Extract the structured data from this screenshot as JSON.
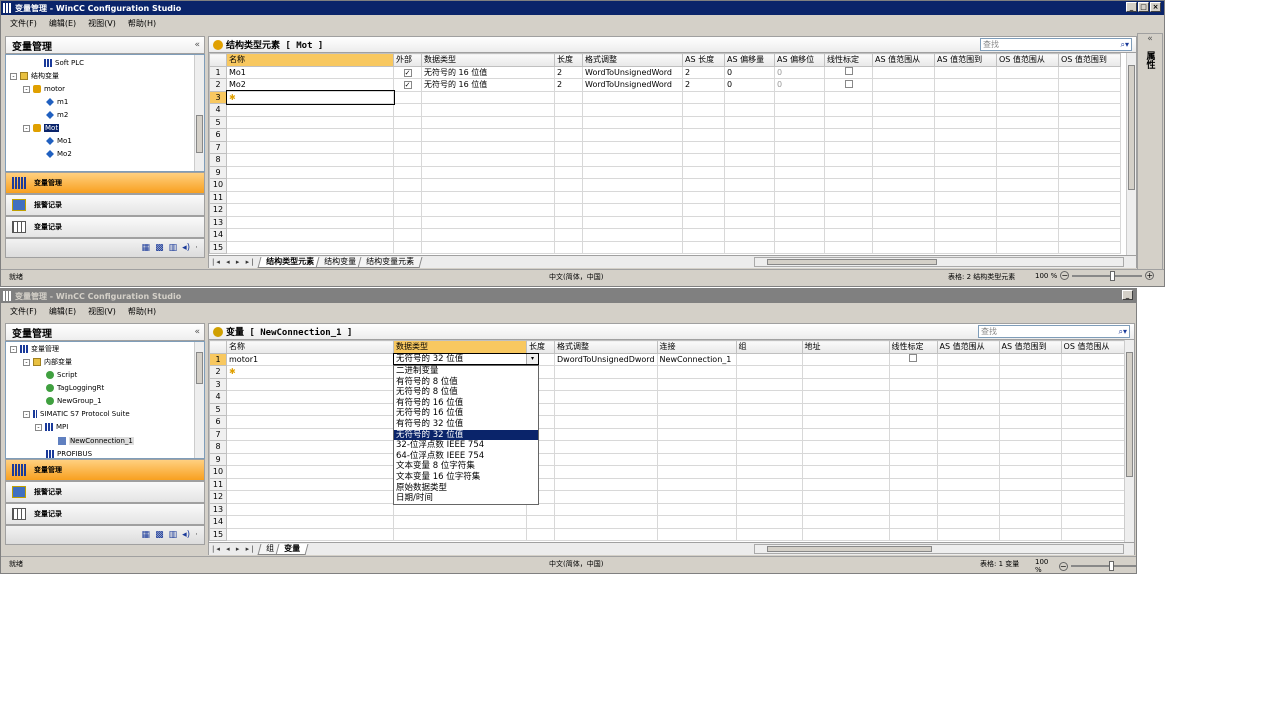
{
  "w1": {
    "title": "变量管理 - WinCC Configuration Studio",
    "menu": [
      "文件(F)",
      "编辑(E)",
      "视图(V)",
      "帮助(H)"
    ],
    "left_title": "变量管理",
    "tree": [
      {
        "label": "Soft PLC",
        "icon": "bars"
      },
      {
        "label": "结构变量",
        "icon": "folder",
        "pm": "-"
      },
      {
        "label": "motor",
        "icon": "struct",
        "pm": "-"
      },
      {
        "label": "m1",
        "icon": "var"
      },
      {
        "label": "m2",
        "icon": "var"
      },
      {
        "label": "Mot",
        "icon": "struct",
        "pm": "-",
        "selected": true
      },
      {
        "label": "Mo1",
        "icon": "var"
      },
      {
        "label": "Mo2",
        "icon": "var"
      }
    ],
    "nav": [
      "变量管理",
      "报警记录",
      "变量记录"
    ],
    "header_icon_label": "结构类型元素 [ Mot ]",
    "search_placeholder": "查找",
    "columns": [
      "名称",
      "外部",
      "数据类型",
      "长度",
      "格式调整",
      "AS 长度",
      "AS 偏移量",
      "AS 偏移位",
      "线性标定",
      "AS 值范围从",
      "AS 值范围到",
      "OS 值范围从",
      "OS 值范围到"
    ],
    "rows": [
      {
        "n": "1",
        "name": "Mo1",
        "ext": "✓",
        "type": "无符号的 16 位值",
        "len": "2",
        "fmt": "WordToUnsignedWord",
        "aslen": "2",
        "asoff": "0",
        "asbit": "0"
      },
      {
        "n": "2",
        "name": "Mo2",
        "ext": "✓",
        "type": "无符号的 16 位值",
        "len": "2",
        "fmt": "WordToUnsignedWord",
        "aslen": "2",
        "asoff": "0",
        "asbit": "0"
      }
    ],
    "empty_rows": [
      "3",
      "4",
      "5",
      "6",
      "7",
      "8",
      "9",
      "10",
      "11",
      "12",
      "13",
      "14",
      "15"
    ],
    "tabs": [
      "结构类型元素",
      "结构变量",
      "结构变量元素"
    ],
    "status_left": "就绪",
    "status_mid": "中文(简体，中国)",
    "status_right": "表格: 2 结构类型元素",
    "zoom": "100 %",
    "right_label": "属性"
  },
  "w2": {
    "title": "变量管理 - WinCC Configuration Studio",
    "menu": [
      "文件(F)",
      "编辑(E)",
      "视图(V)",
      "帮助(H)"
    ],
    "left_title": "变量管理",
    "tree": [
      {
        "label": "变量管理",
        "icon": "bars",
        "pm": "-"
      },
      {
        "label": "内部变量",
        "icon": "folder",
        "pm": "-"
      },
      {
        "label": "Script",
        "icon": "db"
      },
      {
        "label": "TagLoggingRt",
        "icon": "db"
      },
      {
        "label": "NewGroup_1",
        "icon": "db"
      },
      {
        "label": "SIMATIC S7 Protocol Suite",
        "icon": "bars",
        "pm": "-"
      },
      {
        "label": "MPI",
        "icon": "bars",
        "pm": "-"
      },
      {
        "label": "NewConnection_1",
        "icon": "conn",
        "hl": true
      },
      {
        "label": "PROFIBUS",
        "icon": "bars"
      }
    ],
    "nav": [
      "变量管理",
      "报警记录",
      "变量记录"
    ],
    "header_icon_label": "变量 [ NewConnection_1 ]",
    "search_placeholder": "查找",
    "columns": [
      "名称",
      "数据类型",
      "长度",
      "格式调整",
      "连接",
      "组",
      "地址",
      "线性标定",
      "AS 值范围从",
      "AS 值范围到",
      "OS 值范围从"
    ],
    "rows": [
      {
        "n": "1",
        "name": "motor1",
        "type": "无符号的 32 位值",
        "len": "",
        "fmt": "DwordToUnsignedDword",
        "conn": "NewConnection_1"
      }
    ],
    "empty_rows": [
      "2",
      "3",
      "4",
      "5",
      "6",
      "7",
      "8",
      "9",
      "10",
      "11",
      "12",
      "13",
      "14",
      "15"
    ],
    "dropdown": [
      "二进制变量",
      "有符号的 8 位值",
      "无符号的 8 位值",
      "有符号的 16 位值",
      "无符号的 16 位值",
      "有符号的 32 位值",
      "无符号的 32 位值",
      "32-位浮点数 IEEE 754",
      "64-位浮点数 IEEE 754",
      "文本变量 8 位字符集",
      "文本变量 16 位字符集",
      "原始数据类型",
      "日期/时间"
    ],
    "dropdown_selected": 6,
    "tabs": [
      "组",
      "变量"
    ],
    "status_left": "就绪",
    "status_mid": "中文(简体，中国)",
    "status_right": "表格: 1 变量",
    "zoom": "100 %"
  },
  "colors": {
    "accent": "#f8c860",
    "title_active": "#0a246a",
    "title_inactive": "#808080"
  }
}
